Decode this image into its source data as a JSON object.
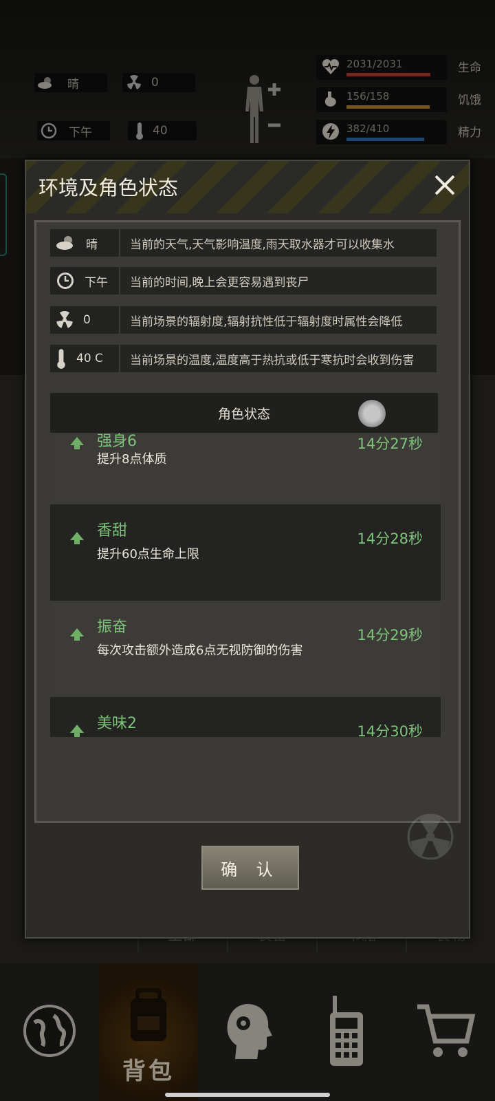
{
  "hud": {
    "weather": "晴",
    "radiation": "0",
    "time": "下午",
    "temperature": "40",
    "stats": [
      {
        "value": "2031/2031",
        "label": "生命",
        "fraction": 1.0,
        "color": "#b33b30",
        "icon": "heart-icon"
      },
      {
        "value": "156/158",
        "label": "饥饿",
        "fraction": 0.99,
        "color": "#b3822e",
        "icon": "stomach-icon"
      },
      {
        "value": "382/410",
        "label": "精力",
        "fraction": 0.93,
        "color": "#2f6aa8",
        "icon": "lightning-icon"
      }
    ]
  },
  "dialog": {
    "title": "环境及角色状态",
    "env": [
      {
        "key": "晴",
        "desc": "当前的天气,天气影响温度,雨天取水器才可以收集水",
        "icon": "weather-icon"
      },
      {
        "key": "下午",
        "desc": "当前的时间,晚上会更容易遇到丧尸",
        "icon": "clock-icon"
      },
      {
        "key": "0",
        "desc": "当前场景的辐射度,辐射抗性低于辐射度时属性会降低",
        "icon": "radiation-icon"
      },
      {
        "key": "40 C",
        "desc": "当前场景的温度,温度高于热抗或低于寒抗时会收到伤害",
        "icon": "thermometer-icon"
      }
    ],
    "status_header": "角色状态",
    "statuses": [
      {
        "name": "强身6",
        "desc": "提升8点体质",
        "time": "14分27秒"
      },
      {
        "name": "香甜",
        "desc": "提升60点生命上限",
        "time": "14分28秒"
      },
      {
        "name": "振奋",
        "desc": "每次攻击额外造成6点无视防御的伤害",
        "time": "14分29秒"
      },
      {
        "name": "美味2",
        "desc": "",
        "time": "14分30秒"
      }
    ],
    "confirm": "确 认"
  },
  "bag_tabs": [
    "全部",
    "装备",
    "书籍",
    "食物"
  ],
  "nav": {
    "active_label": "背包"
  }
}
